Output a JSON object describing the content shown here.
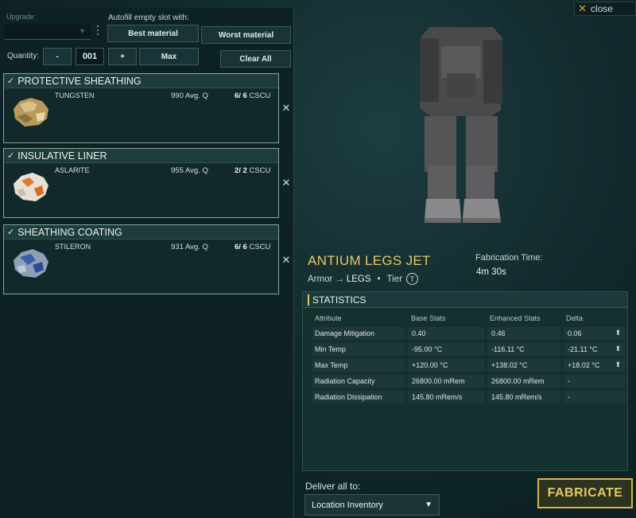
{
  "header": {
    "close_label": "close"
  },
  "left": {
    "upgrade_label": "Upgrade:",
    "autofill_label": "Autofill empty slot with:",
    "best_material_label": "Best material",
    "worst_material_label": "Worst material",
    "quantity_label": "Quantity:",
    "minus_label": "-",
    "quantity_value": "001",
    "plus_label": "+",
    "max_label": "Max",
    "clear_all_label": "Clear All"
  },
  "slots": [
    {
      "title": "PROTECTIVE SHEATHING",
      "material": "TUNGSTEN",
      "avg": "990 Avg. Q",
      "count": "6/ 6",
      "unit": "CSCU"
    },
    {
      "title": "INSULATIVE LINER",
      "material": "ASLARITE",
      "avg": "955 Avg. Q",
      "count": "2/ 2",
      "unit": "CSCU"
    },
    {
      "title": "SHEATHING COATING",
      "material": "STILERON",
      "avg": "931 Avg. Q",
      "count": "6/ 6",
      "unit": "CSCU"
    }
  ],
  "item": {
    "title": "ANTIUM LEGS JET",
    "category": "Armor",
    "subcategory": "LEGS",
    "tier_label": "Tier",
    "tier_value": "T",
    "fab_time_label": "Fabrication Time:",
    "fab_time_value": "4m 30s"
  },
  "statistics": {
    "title": "STATISTICS",
    "headers": {
      "attribute": "Attribute",
      "base": "Base Stats",
      "enhanced": "Enhanced Stats",
      "delta": "Delta"
    },
    "rows": [
      {
        "attribute": "Damage Mitigation",
        "base": "0.40",
        "enhanced": "0.46",
        "delta": "0.06"
      },
      {
        "attribute": "Min Temp",
        "base": "-95.00 °C",
        "enhanced": "-116.11 °C",
        "delta": "-21.11 °C"
      },
      {
        "attribute": "Max Temp",
        "base": "+120.00 °C",
        "enhanced": "+138.02 °C",
        "delta": "+18.02 °C"
      },
      {
        "attribute": "Radiation Capacity",
        "base": "26800.00 mRem",
        "enhanced": "26800.00 mRem",
        "delta": "-"
      },
      {
        "attribute": "Radiation Dissipation",
        "base": "145.80 mRem/s",
        "enhanced": "145.80 mRem/s",
        "delta": "-"
      }
    ]
  },
  "footer": {
    "deliver_label": "Deliver all to:",
    "deliver_value": "Location Inventory",
    "fabricate_label": "FABRICATE"
  },
  "colors": {
    "accent": "#e6c862",
    "slot_border": "#7fa995",
    "delta_up": "#bff0c8"
  },
  "icons": [
    "close-icon",
    "check-icon",
    "chevron-down-icon",
    "arrow-up-icon",
    "remove-icon"
  ]
}
